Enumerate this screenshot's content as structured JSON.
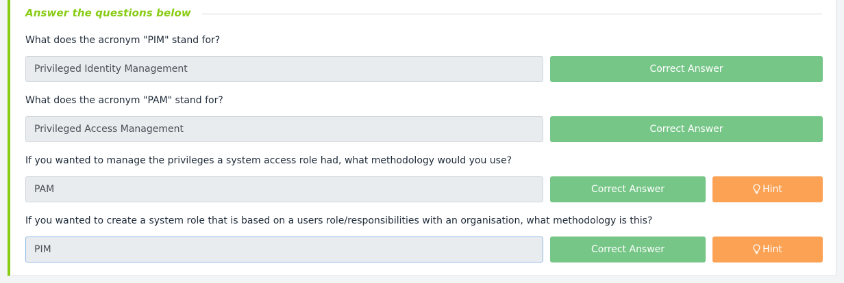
{
  "section": {
    "title": "Answer the questions below"
  },
  "questions": [
    {
      "text": "What does the acronym \"PIM\" stand for?",
      "answer": "Privileged Identity Management",
      "button": "Correct Answer"
    },
    {
      "text": "What does the acronym \"PAM\" stand for?",
      "answer": "Privileged Access Management",
      "button": "Correct Answer"
    },
    {
      "text": "If you wanted to manage the privileges a system access role had, what methodology would you use?",
      "answer": "PAM",
      "button": "Correct Answer",
      "hint": "Hint"
    },
    {
      "text": "If you wanted to create a system role that is based on a users role/responsibilities with an organisation, what methodology is this?",
      "answer": "PIM",
      "button": "Correct Answer",
      "hint": "Hint"
    }
  ],
  "colors": {
    "accent": "#88cc14",
    "correct": "#76c687",
    "hint": "#fba255"
  },
  "icons": {
    "hint": "lightbulb-icon"
  }
}
